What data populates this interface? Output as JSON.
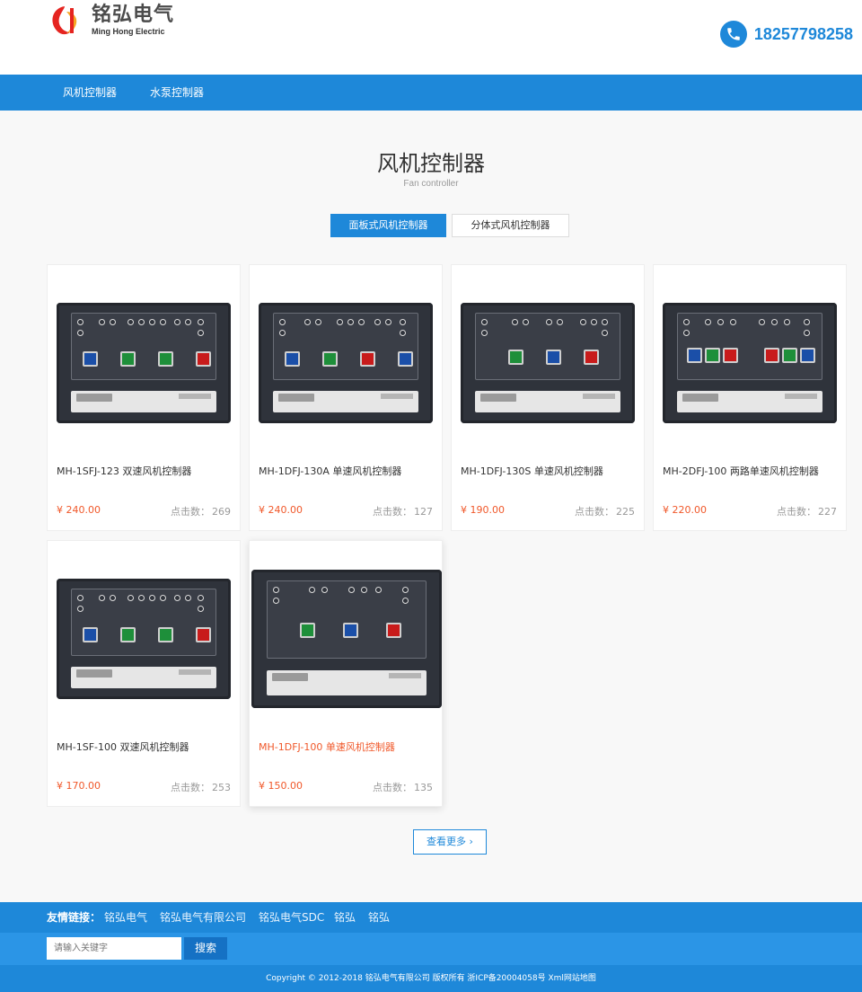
{
  "brand": {
    "name_cn": "铭弘电气",
    "name_en": "Ming Hong Electric",
    "colors": {
      "primary": "#1e88d9",
      "price": "#f0582a",
      "logo_red": "#e52420",
      "logo_yellow": "#f5a623"
    }
  },
  "header": {
    "phone": "18257798258",
    "phone_icon": "phone-icon"
  },
  "nav": {
    "items": [
      {
        "label": "风机控制器"
      },
      {
        "label": "水泵控制器"
      }
    ]
  },
  "section": {
    "title": "风机控制器",
    "subtitle": "Fan controller"
  },
  "tabs": [
    {
      "label": "面板式风机控制器",
      "active": true
    },
    {
      "label": "分体式风机控制器",
      "active": false
    }
  ],
  "products": [
    {
      "name": "MH-1SFJ-123 双速风机控制器",
      "price": "¥ 240.00",
      "clicks_label": "点击数：",
      "clicks": "269"
    },
    {
      "name": "MH-1DFJ-130A 单速风机控制器",
      "price": "¥ 240.00",
      "clicks_label": "点击数：",
      "clicks": "127"
    },
    {
      "name": "MH-1DFJ-130S 单速风机控制器",
      "price": "¥ 190.00",
      "clicks_label": "点击数：",
      "clicks": "225"
    },
    {
      "name": "MH-2DFJ-100 两路单速风机控制器",
      "price": "¥ 220.00",
      "clicks_label": "点击数：",
      "clicks": "227"
    },
    {
      "name": "MH-1SF-100 双速风机控制器",
      "price": "¥ 170.00",
      "clicks_label": "点击数：",
      "clicks": "253"
    },
    {
      "name": "MH-1DFJ-100 单速风机控制器",
      "price": "¥ 150.00",
      "clicks_label": "点击数：",
      "clicks": "135"
    }
  ],
  "more_button": {
    "label": "查看更多 ›"
  },
  "footer": {
    "links_label": "友情链接：",
    "links": [
      "铭弘电气",
      "铭弘电气有限公司",
      "铭弘电气SDC",
      "铭弘",
      "铭弘"
    ],
    "search_placeholder": "请输入关键字",
    "search_button": "搜索",
    "copyright": "Copyright © 2012-2018 铭弘电气有限公司 版权所有   浙ICP备20004058号 Xml网站地图"
  }
}
